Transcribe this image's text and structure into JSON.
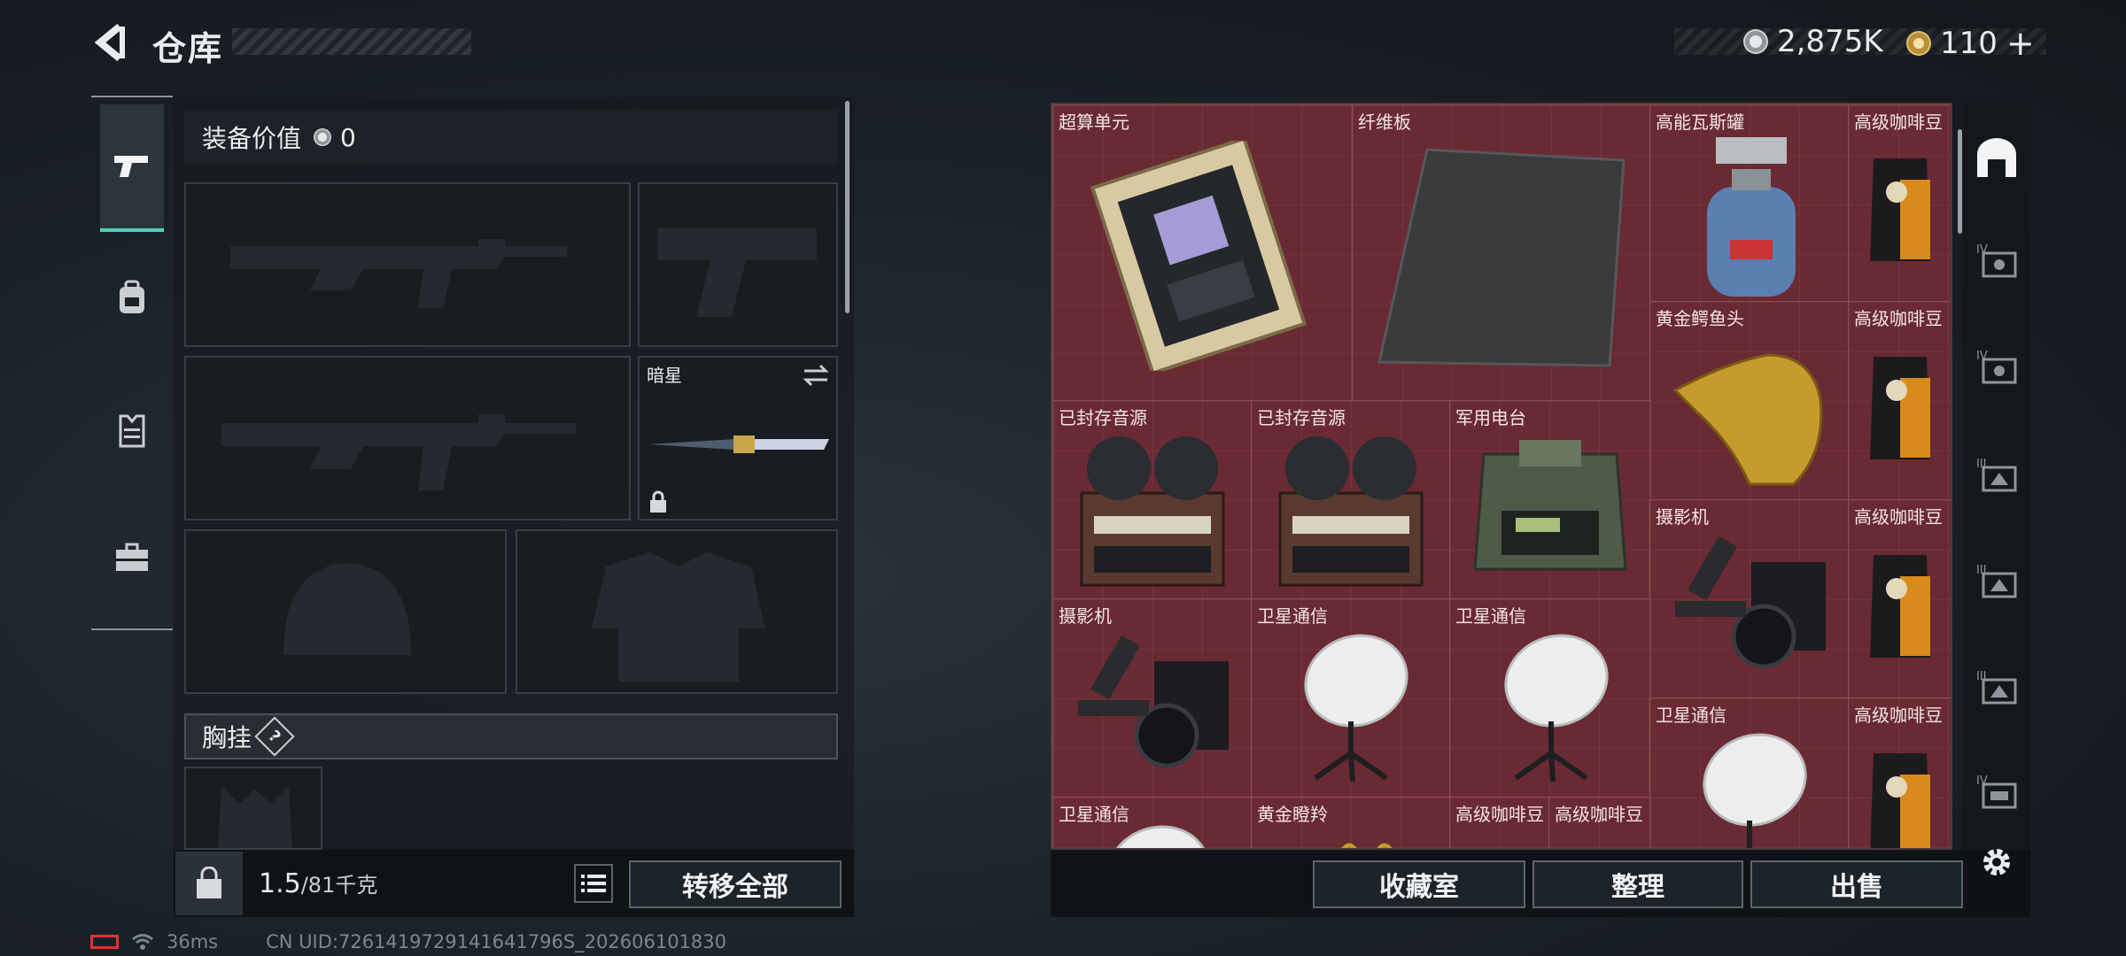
{
  "header": {
    "title": "仓库"
  },
  "currency": {
    "primary": "2,875K",
    "secondary": "110",
    "secondary_add": "+"
  },
  "equipment": {
    "value_label": "装备价值",
    "value": "0",
    "melee_name": "暗星",
    "chest_rig_label": "胸挂",
    "help_symbol": "?"
  },
  "bottom_left": {
    "weight_current": "1.5",
    "weight_max": "/81千克",
    "transfer_all": "转移全部"
  },
  "status": {
    "ping": "36ms",
    "uid": "CN UID:7261419729141641796S_202606101830"
  },
  "storage": {
    "items": [
      {
        "name": "超算单元",
        "icon": "supercomputer-chip-icon"
      },
      {
        "name": "纤维板",
        "icon": "carbon-fiber-board-icon"
      },
      {
        "name": "高能瓦斯罐",
        "icon": "gas-canister-icon"
      },
      {
        "name": "高级咖啡豆",
        "icon": "coffee-bag-icon"
      },
      {
        "name": "黄金鳄鱼头",
        "icon": "golden-crocodile-head-icon"
      },
      {
        "name": "高级咖啡豆",
        "icon": "coffee-bag-icon"
      },
      {
        "name": "已封存音源",
        "icon": "reel-to-reel-icon"
      },
      {
        "name": "已封存音源",
        "icon": "reel-to-reel-icon"
      },
      {
        "name": "军用电台",
        "icon": "military-radio-icon"
      },
      {
        "name": "摄影机",
        "icon": "camera-icon"
      },
      {
        "name": "高级咖啡豆",
        "icon": "coffee-bag-icon"
      },
      {
        "name": "摄影机",
        "icon": "camera-icon"
      },
      {
        "name": "卫星通信",
        "icon": "satellite-dish-icon"
      },
      {
        "name": "卫星通信",
        "icon": "satellite-dish-icon"
      },
      {
        "name": "卫星通信",
        "icon": "satellite-dish-icon"
      },
      {
        "name": "高级咖啡豆",
        "icon": "coffee-bag-icon"
      },
      {
        "name": "卫星通信",
        "icon": "satellite-dish-icon"
      },
      {
        "name": "黄金瞪羚",
        "icon": "golden-gazelle-icon"
      },
      {
        "name": "高级咖啡豆",
        "icon": "coffee-bag-icon"
      },
      {
        "name": "高级咖啡豆",
        "icon": "coffee-bag-icon"
      }
    ],
    "buttons": {
      "collection": "收藏室",
      "organize": "整理",
      "sell": "出售"
    }
  },
  "colors": {
    "accent": "#4fd1b8",
    "storage_cell": "#6a2a33",
    "storage_border": "#8e4c55"
  }
}
